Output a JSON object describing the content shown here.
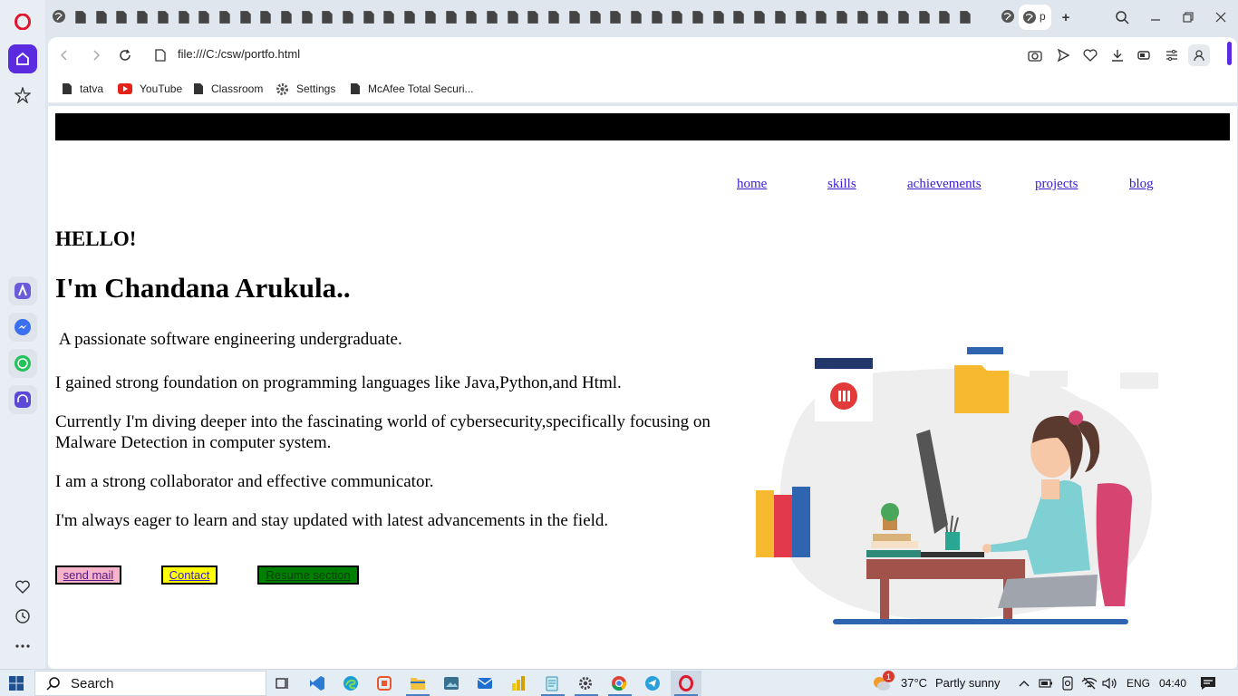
{
  "browser": {
    "url": "file:///C:/csw/portfo.html",
    "active_tab_label": "p",
    "bookmarks": [
      "tatva",
      "YouTube",
      "Classroom",
      "Settings",
      "McAfee Total Securi..."
    ]
  },
  "page": {
    "nav": [
      "home",
      "skills",
      "achievements",
      "projects",
      "blog"
    ],
    "greeting": "HELLO!",
    "name": "I'm Chandana Arukula..",
    "paragraphs": [
      " A passionate software engineering undergraduate.",
      "I gained strong foundation on programming languages like Java,Python,and Html.",
      "Currently I'm diving deeper into the fascinating world of cybersecurity,specifically focusing on Malware Detection in computer system.",
      "I am a strong collaborator and effective communicator.",
      "I'm always eager to learn and stay updated with latest advancements in the field."
    ],
    "buttons": {
      "send_mail": "send mail",
      "contact": "Contact",
      "resume": "Resume section"
    },
    "colors": {
      "send_mail_bg": "#f6b3c9",
      "contact_bg": "#ffff00",
      "resume_bg": "#008000",
      "nav_link": "#3b1bd1"
    }
  },
  "taskbar": {
    "search_label": "Search",
    "weather_temp": "37°C",
    "weather_text": "Partly sunny",
    "weather_badge": "1",
    "language": "ENG",
    "time": "04:40"
  }
}
